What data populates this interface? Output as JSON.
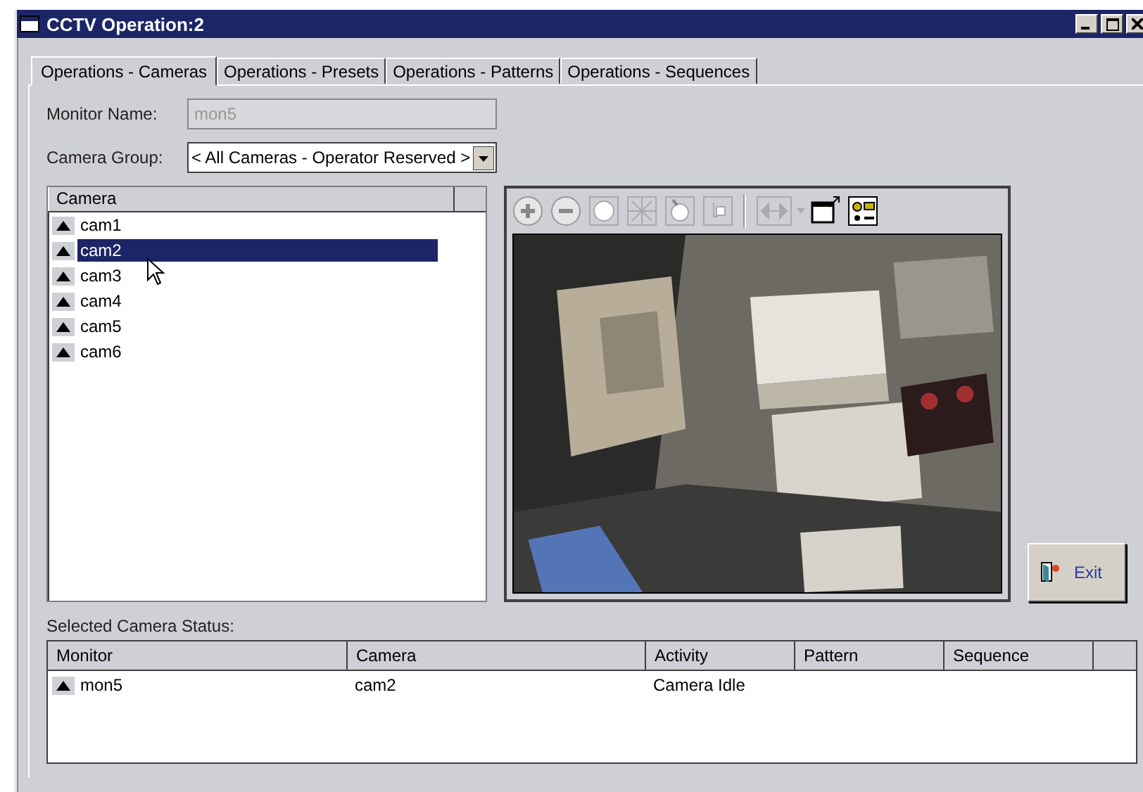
{
  "window": {
    "title": "CCTV Operation:2"
  },
  "tabs": [
    {
      "label": "Operations - Cameras",
      "selected": true
    },
    {
      "label": "Operations - Presets",
      "selected": false
    },
    {
      "label": "Operations - Patterns",
      "selected": false
    },
    {
      "label": "Operations - Sequences",
      "selected": false
    }
  ],
  "monitor_name": {
    "label": "Monitor Name:",
    "value": "mon5",
    "disabled": true
  },
  "camera_group": {
    "label": "Camera Group:",
    "value": "< All Cameras - Operator Reserved >"
  },
  "camera_list": {
    "column": "Camera",
    "items": [
      {
        "name": "cam1",
        "selected": false
      },
      {
        "name": "cam2",
        "selected": true
      },
      {
        "name": "cam3",
        "selected": false
      },
      {
        "name": "cam4",
        "selected": false
      },
      {
        "name": "cam5",
        "selected": false
      },
      {
        "name": "cam6",
        "selected": false
      }
    ]
  },
  "exit_button": {
    "label": "Exit"
  },
  "status": {
    "label": "Selected Camera Status:",
    "columns": [
      "Monitor",
      "Camera",
      "Activity",
      "Pattern",
      "Sequence"
    ],
    "rows": [
      {
        "cells": [
          "mon5",
          "cam2",
          "Camera Idle"
        ]
      }
    ]
  }
}
